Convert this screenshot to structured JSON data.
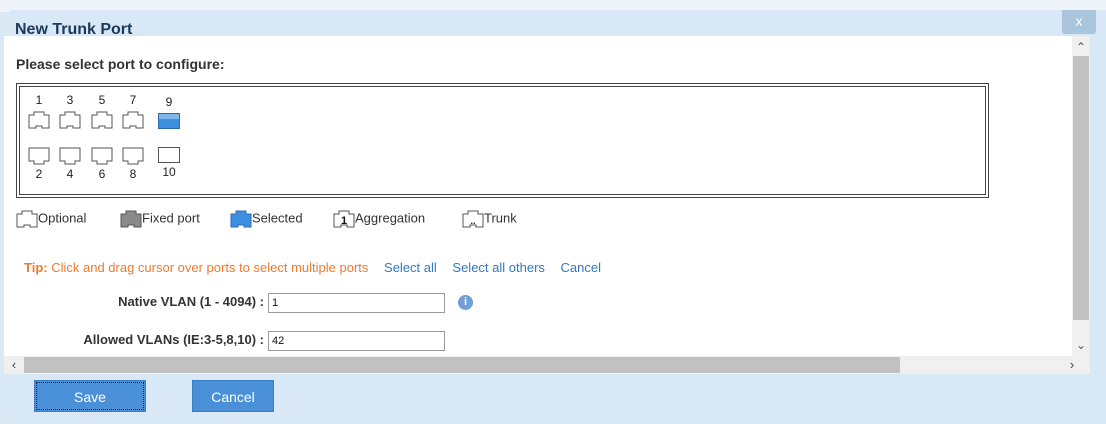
{
  "dialog": {
    "title": "New Trunk Port",
    "close_label": "x"
  },
  "port_panel": {
    "prompt": "Please select port to configure:",
    "top_row": [
      {
        "number": "1",
        "state": "optional"
      },
      {
        "number": "3",
        "state": "optional"
      },
      {
        "number": "5",
        "state": "optional"
      },
      {
        "number": "7",
        "state": "optional"
      },
      {
        "number": "9",
        "state": "selected"
      }
    ],
    "bottom_row": [
      {
        "number": "2",
        "state": "optional"
      },
      {
        "number": "4",
        "state": "optional"
      },
      {
        "number": "6",
        "state": "optional"
      },
      {
        "number": "8",
        "state": "optional"
      },
      {
        "number": "10",
        "state": "empty"
      }
    ]
  },
  "legend": {
    "optional": "Optional",
    "fixed": "Fixed port",
    "selected": "Selected",
    "aggregation": "Aggregation",
    "aggregation_glyph": "1",
    "trunk": "Trunk",
    "trunk_glyph": ".."
  },
  "tip": {
    "label": "Tip:",
    "text": "Click and drag cursor over ports to select multiple ports",
    "select_all": "Select all",
    "select_all_others": "Select all others",
    "cancel": "Cancel"
  },
  "form": {
    "native_vlan_label": "Native VLAN (1 - 4094) :",
    "native_vlan_value": "1",
    "allowed_vlans_label": "Allowed VLANs (IE:3-5,8,10) :",
    "allowed_vlans_value": "42",
    "info_glyph": "i"
  },
  "buttons": {
    "save": "Save",
    "cancel": "Cancel"
  },
  "colors": {
    "title": "#1b3a5a",
    "tip": "#ef7a2b",
    "link": "#3478c2",
    "selected_port": "#3d8fe0",
    "button": "#4a90d9"
  },
  "icons": {
    "close": "close-icon",
    "info": "info-icon",
    "scroll_up": "chevron-up-icon",
    "scroll_down": "chevron-down-icon",
    "scroll_left": "chevron-left-icon",
    "scroll_right": "chevron-right-icon"
  }
}
